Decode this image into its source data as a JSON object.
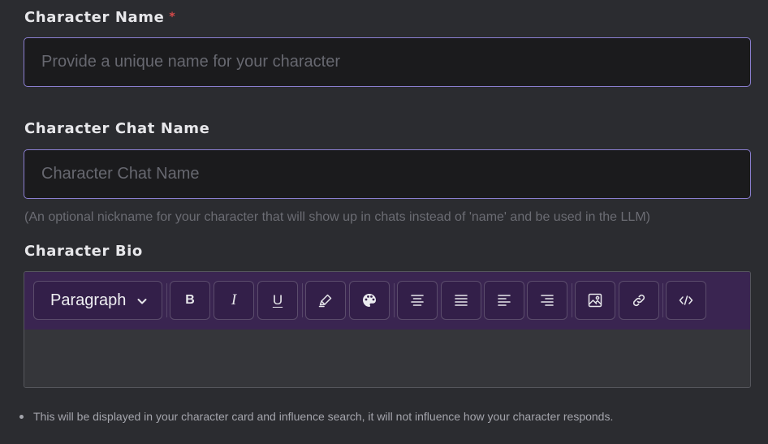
{
  "character_name": {
    "label": "Character Name",
    "required_marker": "*",
    "placeholder": "Provide a unique name for your character",
    "value": ""
  },
  "chat_name": {
    "label": "Character Chat Name",
    "placeholder": "Character Chat Name",
    "value": "",
    "help": "(An optional nickname for your character that will show up in chats instead of 'name' and be used in the LLM)"
  },
  "bio": {
    "label": "Character Bio",
    "toolbar": {
      "block_format": "Paragraph",
      "buttons": [
        {
          "name": "bold",
          "glyph": "B"
        },
        {
          "name": "italic",
          "glyph": "I"
        },
        {
          "name": "underline",
          "glyph": "U"
        },
        {
          "name": "highlight",
          "icon": "highlighter-icon"
        },
        {
          "name": "color",
          "icon": "palette-icon"
        },
        {
          "name": "align-center",
          "icon": "align-center-icon"
        },
        {
          "name": "align-justify",
          "icon": "align-justify-icon"
        },
        {
          "name": "align-left",
          "icon": "align-left-icon"
        },
        {
          "name": "align-right",
          "icon": "align-right-icon"
        },
        {
          "name": "image",
          "icon": "image-icon"
        },
        {
          "name": "link",
          "icon": "link-icon"
        },
        {
          "name": "code",
          "icon": "code-icon"
        }
      ]
    },
    "content": "",
    "note": "This will be displayed in your character card and influence search, it will not influence how your character responds."
  },
  "colors": {
    "background": "#2b2c30",
    "input_background": "#1b1b1d",
    "input_border": "#8b7fd0",
    "toolbar_background": "#3a2551",
    "required": "#d94a4a"
  }
}
